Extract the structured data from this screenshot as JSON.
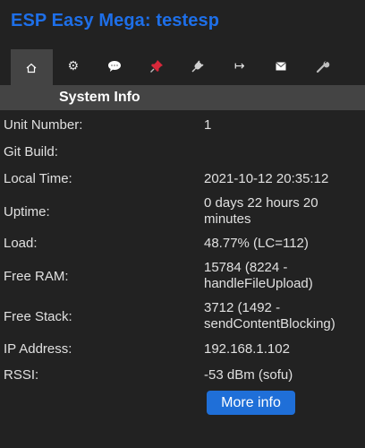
{
  "header": {
    "title": "ESP Easy Mega: testesp"
  },
  "tabs": [
    {
      "icon": "home-icon",
      "glyph": "⌂",
      "active": true
    },
    {
      "icon": "gear-icon",
      "glyph": "⚙",
      "active": false
    },
    {
      "icon": "speech-bubble-icon",
      "glyph": "💬",
      "active": false
    },
    {
      "icon": "pushpin-icon",
      "glyph": "📌",
      "active": false
    },
    {
      "icon": "plug-icon",
      "glyph": "🔌",
      "active": false
    },
    {
      "icon": "arrow-right-icon",
      "glyph": "↦",
      "active": false
    },
    {
      "icon": "envelope-icon",
      "glyph": "✉",
      "active": false
    },
    {
      "icon": "wrench-icon",
      "glyph": "🔧",
      "active": false
    }
  ],
  "section": {
    "title": "System Info"
  },
  "rows": [
    {
      "label": "Unit Number:",
      "value": "1"
    },
    {
      "label": "Git Build:",
      "value": ""
    },
    {
      "label": "Local Time:",
      "value": "2021-10-12 20:35:12"
    },
    {
      "label": "Uptime:",
      "value": "0 days 22 hours 20 minutes"
    },
    {
      "label": "Load:",
      "value": "48.77% (LC=112)"
    },
    {
      "label": "Free RAM:",
      "value": "15784 (8224 - handleFileUpload)"
    },
    {
      "label": "Free Stack:",
      "value": "3712 (1492 - sendContentBlocking)"
    },
    {
      "label": "IP Address:",
      "value": "192.168.1.102"
    },
    {
      "label": "RSSI:",
      "value": "-53 dBm (sofu)"
    }
  ],
  "more_button": {
    "label": "More info"
  },
  "colors": {
    "accent": "#1e6fe8",
    "background": "#222222",
    "header_bar": "#444444"
  }
}
